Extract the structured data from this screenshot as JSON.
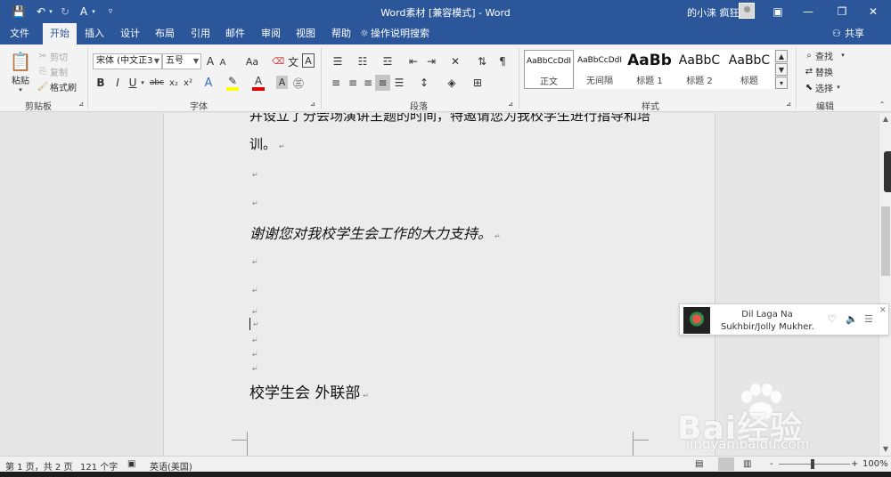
{
  "window": {
    "title": "Word素材 [兼容模式] - Word",
    "user": "的小涞 疯狂",
    "controls": [
      "restore-ribbon",
      "minimize",
      "maximize",
      "close"
    ]
  },
  "tabs": {
    "items": [
      {
        "label": "文件"
      },
      {
        "label": "开始",
        "active": true
      },
      {
        "label": "插入"
      },
      {
        "label": "设计"
      },
      {
        "label": "布局"
      },
      {
        "label": "引用"
      },
      {
        "label": "邮件"
      },
      {
        "label": "审阅"
      },
      {
        "label": "视图"
      },
      {
        "label": "帮助"
      }
    ],
    "tell_me": "操作说明搜索",
    "share": "共享"
  },
  "ribbon": {
    "clipboard": {
      "group_label": "剪贴板",
      "paste": "粘贴",
      "cut": "剪切",
      "copy": "复制",
      "format_painter": "格式刷"
    },
    "font": {
      "group_label": "字体",
      "font_name": "宋体 (中文正3",
      "font_size": "五号",
      "buttons": [
        "A",
        "A",
        "Aa",
        "A",
        "B",
        "I",
        "U",
        "abc",
        "x₂",
        "x²",
        "A",
        "A",
        "A"
      ]
    },
    "paragraph": {
      "group_label": "段落"
    },
    "styles": {
      "group_label": "样式",
      "items": [
        {
          "preview": "AaBbCcDdI",
          "name": "正文"
        },
        {
          "preview": "AaBbCcDdI",
          "name": "无间隔"
        },
        {
          "preview": "AaBb",
          "name": "标题 1"
        },
        {
          "preview": "AaBbC",
          "name": "标题 2"
        },
        {
          "preview": "AaBbC",
          "name": "标题"
        }
      ]
    },
    "editing": {
      "group_label": "编辑",
      "find": "查找",
      "replace": "替换",
      "select": "选择"
    }
  },
  "document": {
    "lines": [
      "并设立了分会场演讲主题的时间，特邀请您为我校学生进行指导和培",
      "训。",
      "",
      "",
      "谢谢您对我校学生会工作的大力支持。",
      "",
      "",
      "",
      "",
      "",
      "",
      "",
      "校学生会  外联部"
    ],
    "paragraph_mark": "↵"
  },
  "music_popup": {
    "title": "Dil Laga Na",
    "artist": "Sukhbir/Jolly Mukher..."
  },
  "status": {
    "page": "第 1 页，共 2 页",
    "words": "121 个字",
    "language": "英语(美国)",
    "zoom": "100%",
    "zoom_minus": "-",
    "zoom_plus": "+"
  },
  "watermark": {
    "logo": "Bai经验",
    "url": "jingyan.baidu.com"
  },
  "colors": {
    "accent": "#2b579a",
    "ribbon": "#f3f3f3",
    "page": "#ececec",
    "highlight": "#ffff00",
    "font_color": "#e00000"
  }
}
